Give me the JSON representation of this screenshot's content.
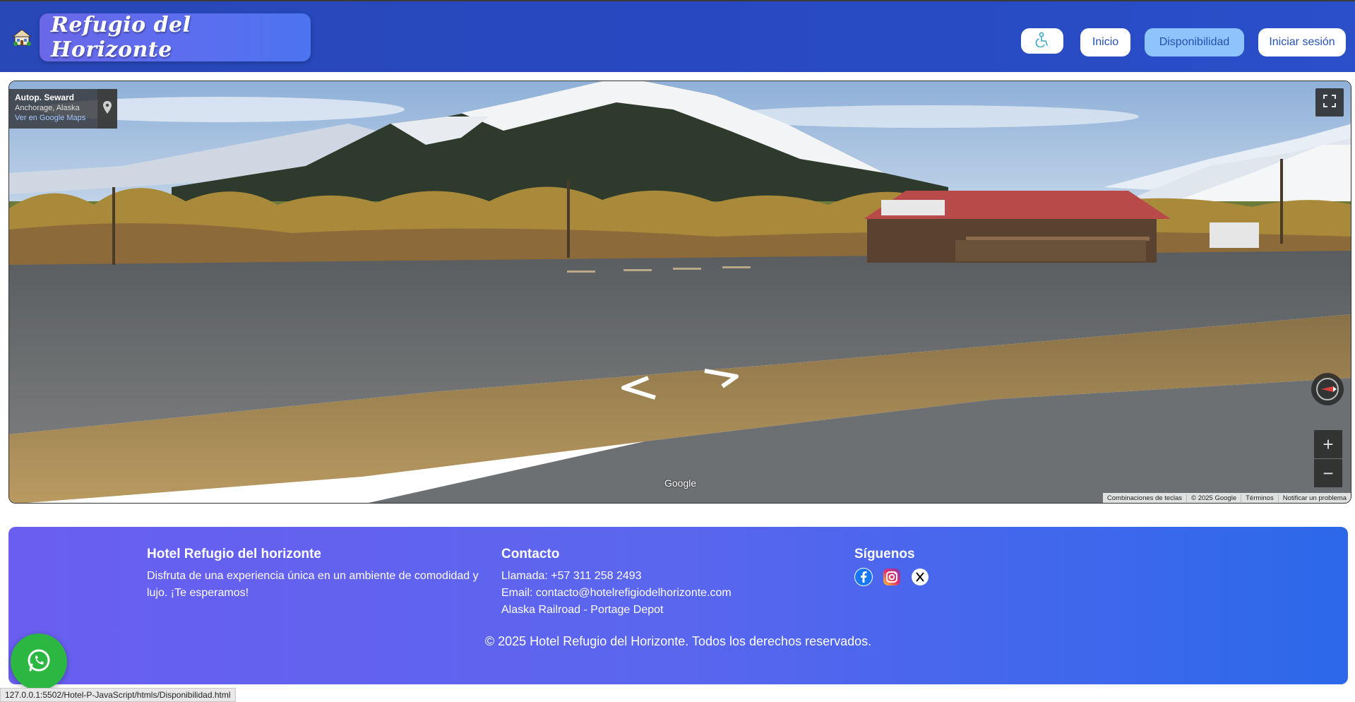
{
  "header": {
    "brand": "Refugio del Horizonte",
    "nav": {
      "access_icon": "accessibility-icon",
      "inicio": "Inicio",
      "disponibilidad": "Disponibilidad",
      "login": "Iniciar sesión"
    },
    "accent_active": "#8cc4fb"
  },
  "map": {
    "place_title": "Autop. Seward",
    "place_sub": "Anchorage, Alaska",
    "place_link": "Ver en Google Maps",
    "watermark": "Google",
    "zoom_in": "+",
    "zoom_out": "−",
    "footer_links": [
      "Combinaciones de teclas",
      "© 2025 Google",
      "Términos",
      "Notificar un problema"
    ]
  },
  "footer": {
    "col1_title": "Hotel Refugio del horizonte",
    "col1_text": "Disfruta de una experiencia única en un ambiente de comodidad y lujo. ¡Te esperamos!",
    "col2_title": "Contacto",
    "col2_phone": "Llamada: +57 311 258 2493",
    "col2_email": "Email: contacto@hotelrefigiodelhorizonte.com",
    "col2_address": "Alaska Railroad - Portage Depot",
    "col3_title": "Síguenos",
    "social_icons": [
      "facebook-icon",
      "instagram-icon",
      "x-icon"
    ],
    "copyright": "© 2025 Hotel Refugio del Horizonte. Todos los derechos reservados."
  },
  "status_url": "127.0.0.1:5502/Hotel-P-JavaScript/htmls/Disponibilidad.html"
}
